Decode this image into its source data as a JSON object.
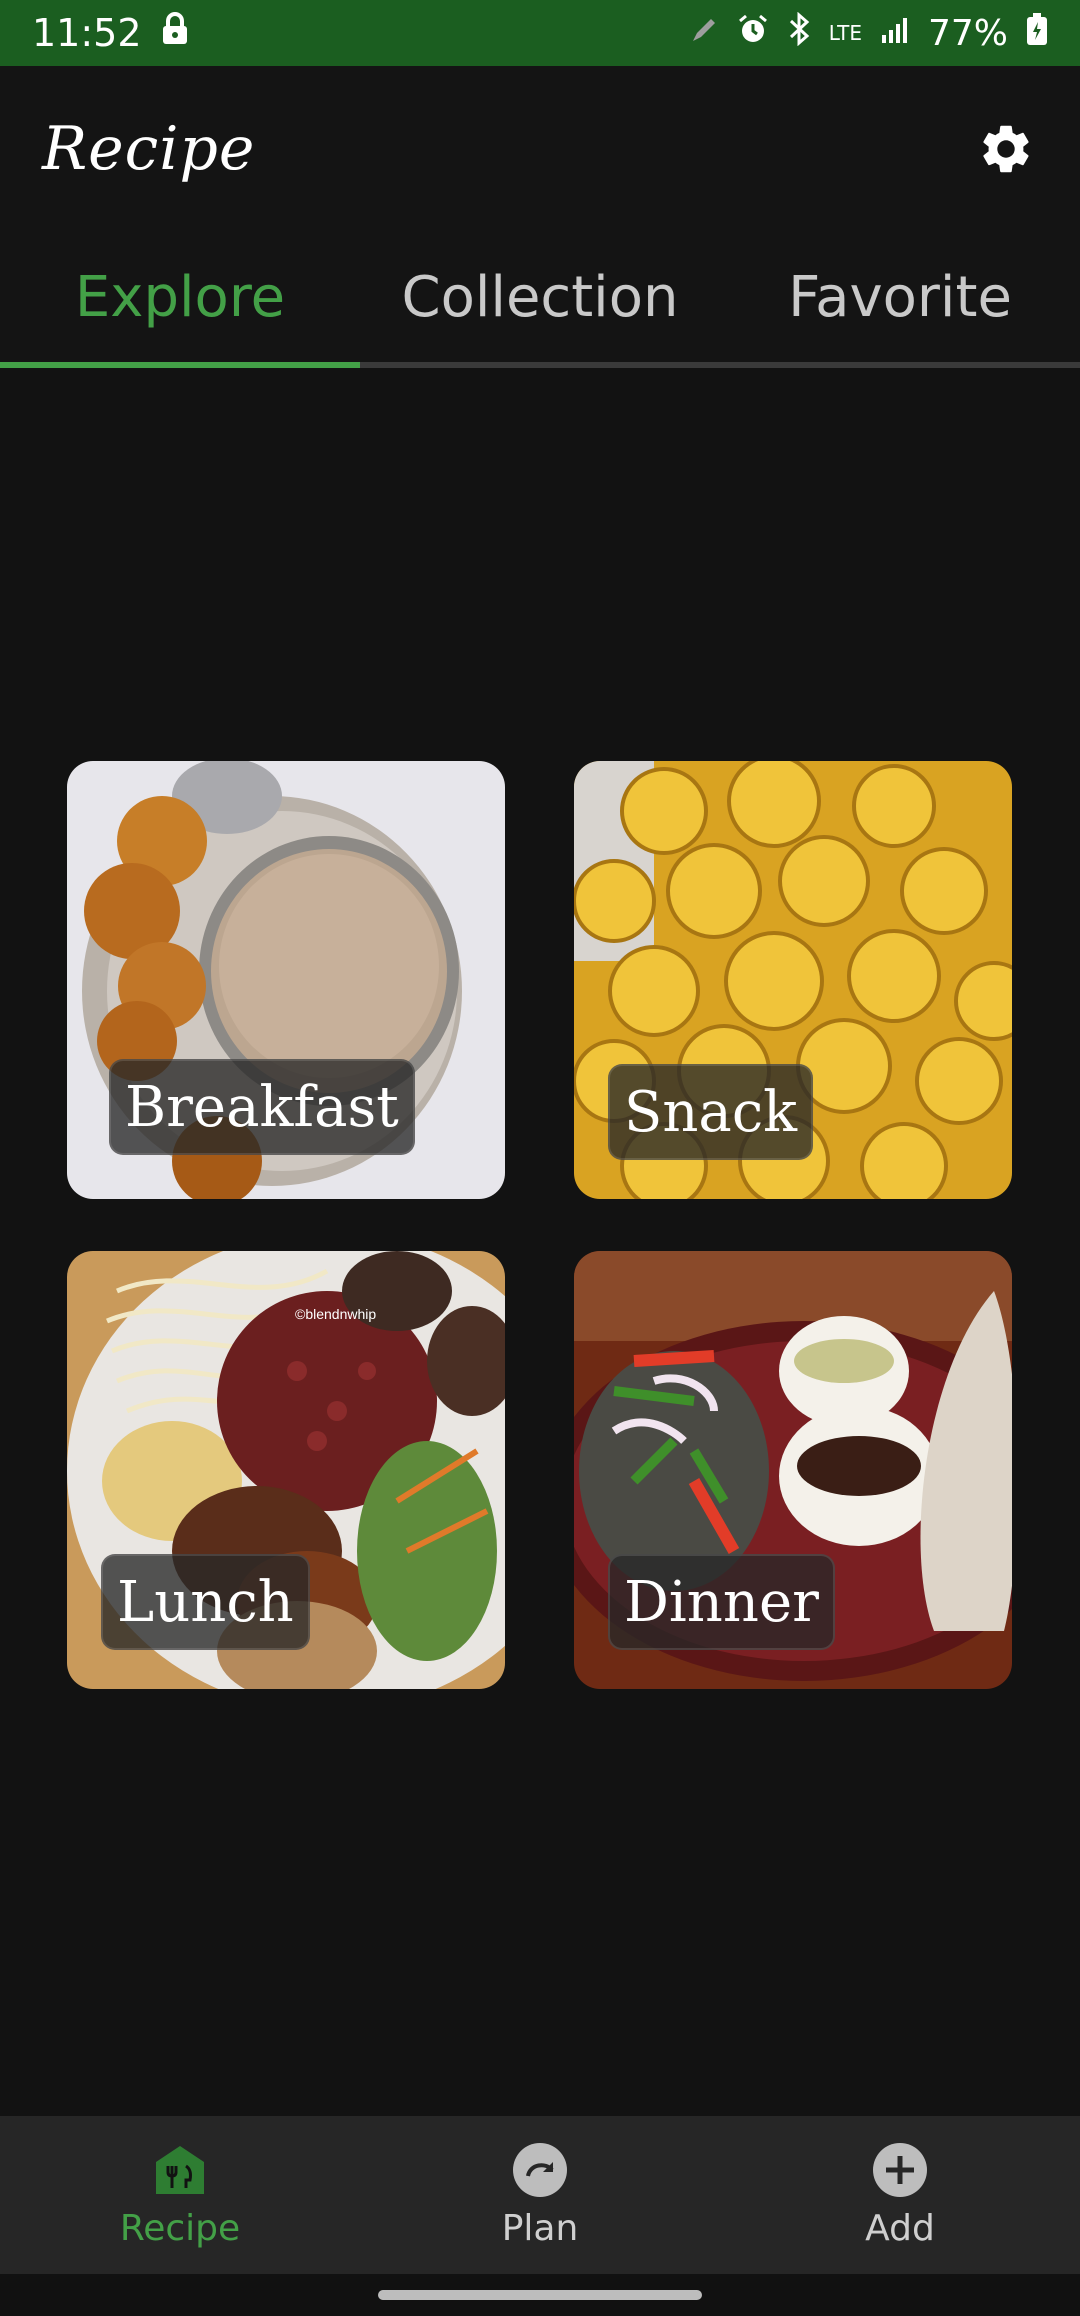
{
  "status": {
    "time": "11:52",
    "network": "LTE",
    "battery": "77%"
  },
  "app": {
    "title": "Recipe"
  },
  "tabs": [
    {
      "label": "Explore",
      "active": true
    },
    {
      "label": "Collection",
      "active": false
    },
    {
      "label": "Favorite",
      "active": false
    }
  ],
  "categories": [
    {
      "label": "Breakfast"
    },
    {
      "label": "Snack"
    },
    {
      "label": "Lunch"
    },
    {
      "label": "Dinner"
    }
  ],
  "watermark": "©blendnwhip",
  "bottom_nav": [
    {
      "label": "Recipe",
      "icon": "home-fork-knife-icon",
      "active": true
    },
    {
      "label": "Plan",
      "icon": "redo-circle-icon",
      "active": false
    },
    {
      "label": "Add",
      "icon": "plus-circle-icon",
      "active": false
    }
  ],
  "colors": {
    "accent": "#43a047",
    "status_bar": "#1b5e20",
    "background": "#121212"
  }
}
